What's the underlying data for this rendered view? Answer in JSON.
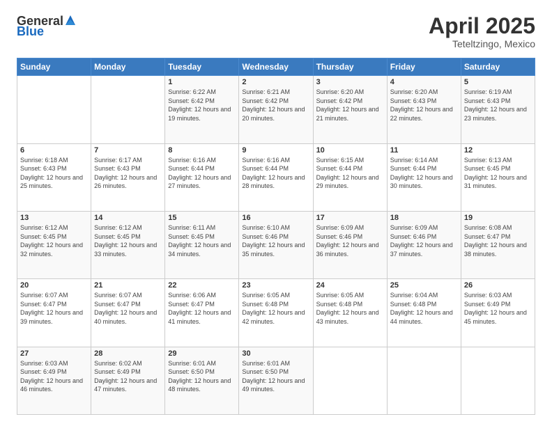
{
  "header": {
    "logo_general": "General",
    "logo_blue": "Blue",
    "title": "April 2025",
    "subtitle": "Teteltzingo, Mexico"
  },
  "days_of_week": [
    "Sunday",
    "Monday",
    "Tuesday",
    "Wednesday",
    "Thursday",
    "Friday",
    "Saturday"
  ],
  "weeks": [
    [
      {
        "day": "",
        "sunrise": "",
        "sunset": "",
        "daylight": ""
      },
      {
        "day": "",
        "sunrise": "",
        "sunset": "",
        "daylight": ""
      },
      {
        "day": "1",
        "sunrise": "Sunrise: 6:22 AM",
        "sunset": "Sunset: 6:42 PM",
        "daylight": "Daylight: 12 hours and 19 minutes."
      },
      {
        "day": "2",
        "sunrise": "Sunrise: 6:21 AM",
        "sunset": "Sunset: 6:42 PM",
        "daylight": "Daylight: 12 hours and 20 minutes."
      },
      {
        "day": "3",
        "sunrise": "Sunrise: 6:20 AM",
        "sunset": "Sunset: 6:42 PM",
        "daylight": "Daylight: 12 hours and 21 minutes."
      },
      {
        "day": "4",
        "sunrise": "Sunrise: 6:20 AM",
        "sunset": "Sunset: 6:43 PM",
        "daylight": "Daylight: 12 hours and 22 minutes."
      },
      {
        "day": "5",
        "sunrise": "Sunrise: 6:19 AM",
        "sunset": "Sunset: 6:43 PM",
        "daylight": "Daylight: 12 hours and 23 minutes."
      }
    ],
    [
      {
        "day": "6",
        "sunrise": "Sunrise: 6:18 AM",
        "sunset": "Sunset: 6:43 PM",
        "daylight": "Daylight: 12 hours and 25 minutes."
      },
      {
        "day": "7",
        "sunrise": "Sunrise: 6:17 AM",
        "sunset": "Sunset: 6:43 PM",
        "daylight": "Daylight: 12 hours and 26 minutes."
      },
      {
        "day": "8",
        "sunrise": "Sunrise: 6:16 AM",
        "sunset": "Sunset: 6:44 PM",
        "daylight": "Daylight: 12 hours and 27 minutes."
      },
      {
        "day": "9",
        "sunrise": "Sunrise: 6:16 AM",
        "sunset": "Sunset: 6:44 PM",
        "daylight": "Daylight: 12 hours and 28 minutes."
      },
      {
        "day": "10",
        "sunrise": "Sunrise: 6:15 AM",
        "sunset": "Sunset: 6:44 PM",
        "daylight": "Daylight: 12 hours and 29 minutes."
      },
      {
        "day": "11",
        "sunrise": "Sunrise: 6:14 AM",
        "sunset": "Sunset: 6:44 PM",
        "daylight": "Daylight: 12 hours and 30 minutes."
      },
      {
        "day": "12",
        "sunrise": "Sunrise: 6:13 AM",
        "sunset": "Sunset: 6:45 PM",
        "daylight": "Daylight: 12 hours and 31 minutes."
      }
    ],
    [
      {
        "day": "13",
        "sunrise": "Sunrise: 6:12 AM",
        "sunset": "Sunset: 6:45 PM",
        "daylight": "Daylight: 12 hours and 32 minutes."
      },
      {
        "day": "14",
        "sunrise": "Sunrise: 6:12 AM",
        "sunset": "Sunset: 6:45 PM",
        "daylight": "Daylight: 12 hours and 33 minutes."
      },
      {
        "day": "15",
        "sunrise": "Sunrise: 6:11 AM",
        "sunset": "Sunset: 6:45 PM",
        "daylight": "Daylight: 12 hours and 34 minutes."
      },
      {
        "day": "16",
        "sunrise": "Sunrise: 6:10 AM",
        "sunset": "Sunset: 6:46 PM",
        "daylight": "Daylight: 12 hours and 35 minutes."
      },
      {
        "day": "17",
        "sunrise": "Sunrise: 6:09 AM",
        "sunset": "Sunset: 6:46 PM",
        "daylight": "Daylight: 12 hours and 36 minutes."
      },
      {
        "day": "18",
        "sunrise": "Sunrise: 6:09 AM",
        "sunset": "Sunset: 6:46 PM",
        "daylight": "Daylight: 12 hours and 37 minutes."
      },
      {
        "day": "19",
        "sunrise": "Sunrise: 6:08 AM",
        "sunset": "Sunset: 6:47 PM",
        "daylight": "Daylight: 12 hours and 38 minutes."
      }
    ],
    [
      {
        "day": "20",
        "sunrise": "Sunrise: 6:07 AM",
        "sunset": "Sunset: 6:47 PM",
        "daylight": "Daylight: 12 hours and 39 minutes."
      },
      {
        "day": "21",
        "sunrise": "Sunrise: 6:07 AM",
        "sunset": "Sunset: 6:47 PM",
        "daylight": "Daylight: 12 hours and 40 minutes."
      },
      {
        "day": "22",
        "sunrise": "Sunrise: 6:06 AM",
        "sunset": "Sunset: 6:47 PM",
        "daylight": "Daylight: 12 hours and 41 minutes."
      },
      {
        "day": "23",
        "sunrise": "Sunrise: 6:05 AM",
        "sunset": "Sunset: 6:48 PM",
        "daylight": "Daylight: 12 hours and 42 minutes."
      },
      {
        "day": "24",
        "sunrise": "Sunrise: 6:05 AM",
        "sunset": "Sunset: 6:48 PM",
        "daylight": "Daylight: 12 hours and 43 minutes."
      },
      {
        "day": "25",
        "sunrise": "Sunrise: 6:04 AM",
        "sunset": "Sunset: 6:48 PM",
        "daylight": "Daylight: 12 hours and 44 minutes."
      },
      {
        "day": "26",
        "sunrise": "Sunrise: 6:03 AM",
        "sunset": "Sunset: 6:49 PM",
        "daylight": "Daylight: 12 hours and 45 minutes."
      }
    ],
    [
      {
        "day": "27",
        "sunrise": "Sunrise: 6:03 AM",
        "sunset": "Sunset: 6:49 PM",
        "daylight": "Daylight: 12 hours and 46 minutes."
      },
      {
        "day": "28",
        "sunrise": "Sunrise: 6:02 AM",
        "sunset": "Sunset: 6:49 PM",
        "daylight": "Daylight: 12 hours and 47 minutes."
      },
      {
        "day": "29",
        "sunrise": "Sunrise: 6:01 AM",
        "sunset": "Sunset: 6:50 PM",
        "daylight": "Daylight: 12 hours and 48 minutes."
      },
      {
        "day": "30",
        "sunrise": "Sunrise: 6:01 AM",
        "sunset": "Sunset: 6:50 PM",
        "daylight": "Daylight: 12 hours and 49 minutes."
      },
      {
        "day": "",
        "sunrise": "",
        "sunset": "",
        "daylight": ""
      },
      {
        "day": "",
        "sunrise": "",
        "sunset": "",
        "daylight": ""
      },
      {
        "day": "",
        "sunrise": "",
        "sunset": "",
        "daylight": ""
      }
    ]
  ]
}
